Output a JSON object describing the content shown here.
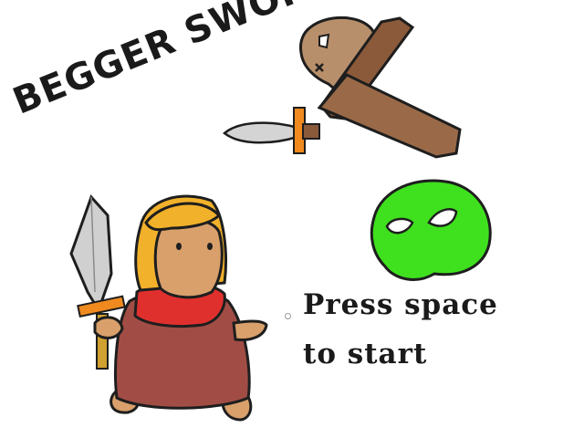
{
  "game": {
    "title": "BEGGER SWORD",
    "prompt_line1": "Press space",
    "prompt_line2": "to start"
  },
  "sprites": {
    "hero": "hero-with-sword",
    "enemy": "green-slime-enemy",
    "emblem": "skull-and-crossed-sword-emblem"
  },
  "colors": {
    "hero_hair": "#f1b12a",
    "hero_skin": "#d9a06b",
    "hero_tunic": "#a14d45",
    "hero_scarf": "#e0302e",
    "slime": "#3fe01e",
    "skull": "#b88f6b",
    "wood": "#8a5a3a",
    "guard": "#f08a1e",
    "blade": "#c8c8c8"
  }
}
